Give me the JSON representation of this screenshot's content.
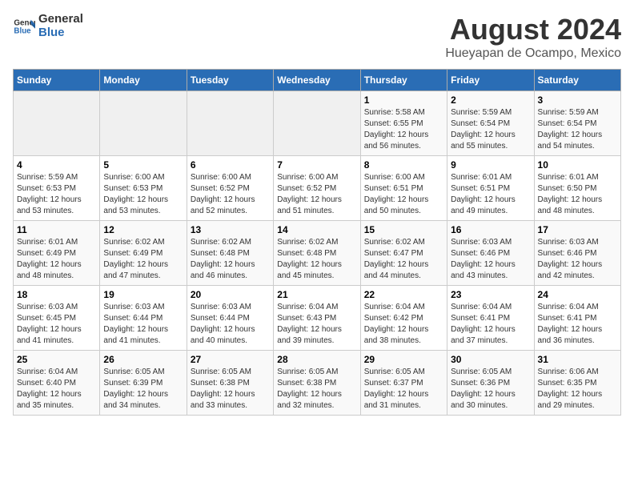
{
  "header": {
    "logo_general": "General",
    "logo_blue": "Blue",
    "title": "August 2024",
    "subtitle": "Hueyapan de Ocampo, Mexico"
  },
  "calendar": {
    "days_of_week": [
      "Sunday",
      "Monday",
      "Tuesday",
      "Wednesday",
      "Thursday",
      "Friday",
      "Saturday"
    ],
    "weeks": [
      [
        {
          "day": "",
          "info": ""
        },
        {
          "day": "",
          "info": ""
        },
        {
          "day": "",
          "info": ""
        },
        {
          "day": "",
          "info": ""
        },
        {
          "day": "1",
          "info": "Sunrise: 5:58 AM\nSunset: 6:55 PM\nDaylight: 12 hours\nand 56 minutes."
        },
        {
          "day": "2",
          "info": "Sunrise: 5:59 AM\nSunset: 6:54 PM\nDaylight: 12 hours\nand 55 minutes."
        },
        {
          "day": "3",
          "info": "Sunrise: 5:59 AM\nSunset: 6:54 PM\nDaylight: 12 hours\nand 54 minutes."
        }
      ],
      [
        {
          "day": "4",
          "info": "Sunrise: 5:59 AM\nSunset: 6:53 PM\nDaylight: 12 hours\nand 53 minutes."
        },
        {
          "day": "5",
          "info": "Sunrise: 6:00 AM\nSunset: 6:53 PM\nDaylight: 12 hours\nand 53 minutes."
        },
        {
          "day": "6",
          "info": "Sunrise: 6:00 AM\nSunset: 6:52 PM\nDaylight: 12 hours\nand 52 minutes."
        },
        {
          "day": "7",
          "info": "Sunrise: 6:00 AM\nSunset: 6:52 PM\nDaylight: 12 hours\nand 51 minutes."
        },
        {
          "day": "8",
          "info": "Sunrise: 6:00 AM\nSunset: 6:51 PM\nDaylight: 12 hours\nand 50 minutes."
        },
        {
          "day": "9",
          "info": "Sunrise: 6:01 AM\nSunset: 6:51 PM\nDaylight: 12 hours\nand 49 minutes."
        },
        {
          "day": "10",
          "info": "Sunrise: 6:01 AM\nSunset: 6:50 PM\nDaylight: 12 hours\nand 48 minutes."
        }
      ],
      [
        {
          "day": "11",
          "info": "Sunrise: 6:01 AM\nSunset: 6:49 PM\nDaylight: 12 hours\nand 48 minutes."
        },
        {
          "day": "12",
          "info": "Sunrise: 6:02 AM\nSunset: 6:49 PM\nDaylight: 12 hours\nand 47 minutes."
        },
        {
          "day": "13",
          "info": "Sunrise: 6:02 AM\nSunset: 6:48 PM\nDaylight: 12 hours\nand 46 minutes."
        },
        {
          "day": "14",
          "info": "Sunrise: 6:02 AM\nSunset: 6:48 PM\nDaylight: 12 hours\nand 45 minutes."
        },
        {
          "day": "15",
          "info": "Sunrise: 6:02 AM\nSunset: 6:47 PM\nDaylight: 12 hours\nand 44 minutes."
        },
        {
          "day": "16",
          "info": "Sunrise: 6:03 AM\nSunset: 6:46 PM\nDaylight: 12 hours\nand 43 minutes."
        },
        {
          "day": "17",
          "info": "Sunrise: 6:03 AM\nSunset: 6:46 PM\nDaylight: 12 hours\nand 42 minutes."
        }
      ],
      [
        {
          "day": "18",
          "info": "Sunrise: 6:03 AM\nSunset: 6:45 PM\nDaylight: 12 hours\nand 41 minutes."
        },
        {
          "day": "19",
          "info": "Sunrise: 6:03 AM\nSunset: 6:44 PM\nDaylight: 12 hours\nand 41 minutes."
        },
        {
          "day": "20",
          "info": "Sunrise: 6:03 AM\nSunset: 6:44 PM\nDaylight: 12 hours\nand 40 minutes."
        },
        {
          "day": "21",
          "info": "Sunrise: 6:04 AM\nSunset: 6:43 PM\nDaylight: 12 hours\nand 39 minutes."
        },
        {
          "day": "22",
          "info": "Sunrise: 6:04 AM\nSunset: 6:42 PM\nDaylight: 12 hours\nand 38 minutes."
        },
        {
          "day": "23",
          "info": "Sunrise: 6:04 AM\nSunset: 6:41 PM\nDaylight: 12 hours\nand 37 minutes."
        },
        {
          "day": "24",
          "info": "Sunrise: 6:04 AM\nSunset: 6:41 PM\nDaylight: 12 hours\nand 36 minutes."
        }
      ],
      [
        {
          "day": "25",
          "info": "Sunrise: 6:04 AM\nSunset: 6:40 PM\nDaylight: 12 hours\nand 35 minutes."
        },
        {
          "day": "26",
          "info": "Sunrise: 6:05 AM\nSunset: 6:39 PM\nDaylight: 12 hours\nand 34 minutes."
        },
        {
          "day": "27",
          "info": "Sunrise: 6:05 AM\nSunset: 6:38 PM\nDaylight: 12 hours\nand 33 minutes."
        },
        {
          "day": "28",
          "info": "Sunrise: 6:05 AM\nSunset: 6:38 PM\nDaylight: 12 hours\nand 32 minutes."
        },
        {
          "day": "29",
          "info": "Sunrise: 6:05 AM\nSunset: 6:37 PM\nDaylight: 12 hours\nand 31 minutes."
        },
        {
          "day": "30",
          "info": "Sunrise: 6:05 AM\nSunset: 6:36 PM\nDaylight: 12 hours\nand 30 minutes."
        },
        {
          "day": "31",
          "info": "Sunrise: 6:06 AM\nSunset: 6:35 PM\nDaylight: 12 hours\nand 29 minutes."
        }
      ]
    ]
  }
}
